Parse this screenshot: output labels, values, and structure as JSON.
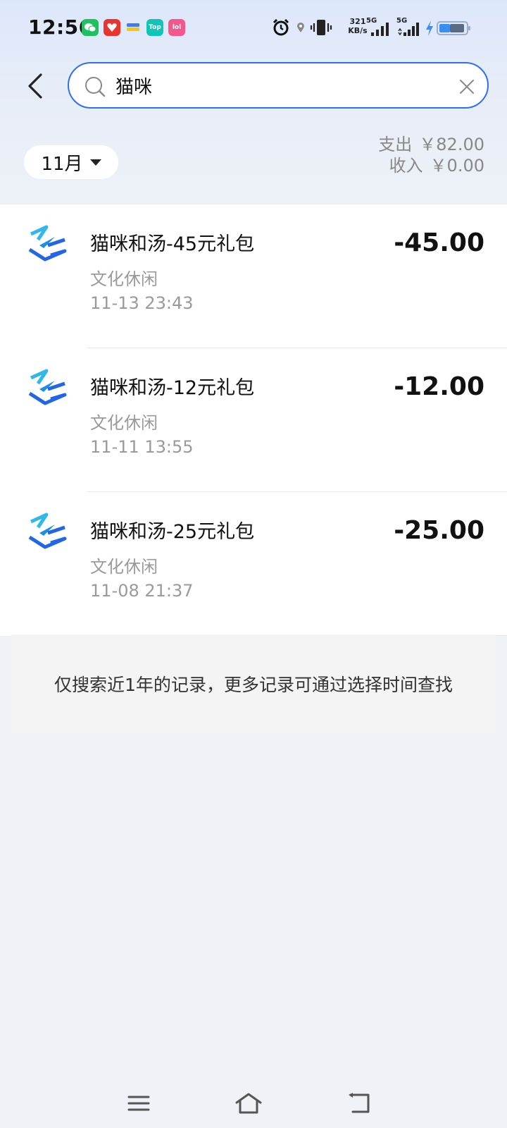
{
  "status_bar": {
    "time": "12:56",
    "net_speed_value": "321",
    "net_speed_unit": "KB/s",
    "sim1_label": "5G",
    "sim2_label": "5G",
    "app_icons": [
      "wechat-icon",
      "taobao-icon",
      "app-icon",
      "top-app-icon",
      "pink-app-icon"
    ],
    "app_badges": {
      "top": "Top",
      "pink": "lol"
    },
    "battery_level": 0.75
  },
  "search": {
    "query": "猫咪",
    "placeholder": ""
  },
  "filter": {
    "month_label": "11月"
  },
  "summary": {
    "expense_label": "支出",
    "expense_value": "￥82.00",
    "income_label": "收入",
    "income_value": "￥0.00"
  },
  "transactions": [
    {
      "title": "猫咪和汤-45元礼包",
      "category": "文化休闲",
      "time": "11-13 23:43",
      "amount": "-45.00"
    },
    {
      "title": "猫咪和汤-12元礼包",
      "category": "文化休闲",
      "time": "11-11 13:55",
      "amount": "-12.00"
    },
    {
      "title": "猫咪和汤-25元礼包",
      "category": "文化休闲",
      "time": "11-08 21:37",
      "amount": "-25.00"
    }
  ],
  "notice": {
    "text": "仅搜索近1年的记录，更多记录可通过选择时间查找"
  },
  "colors": {
    "accent": "#2f6ff0",
    "muted_text": "#9a9a9a",
    "background": "#eff2f7"
  }
}
